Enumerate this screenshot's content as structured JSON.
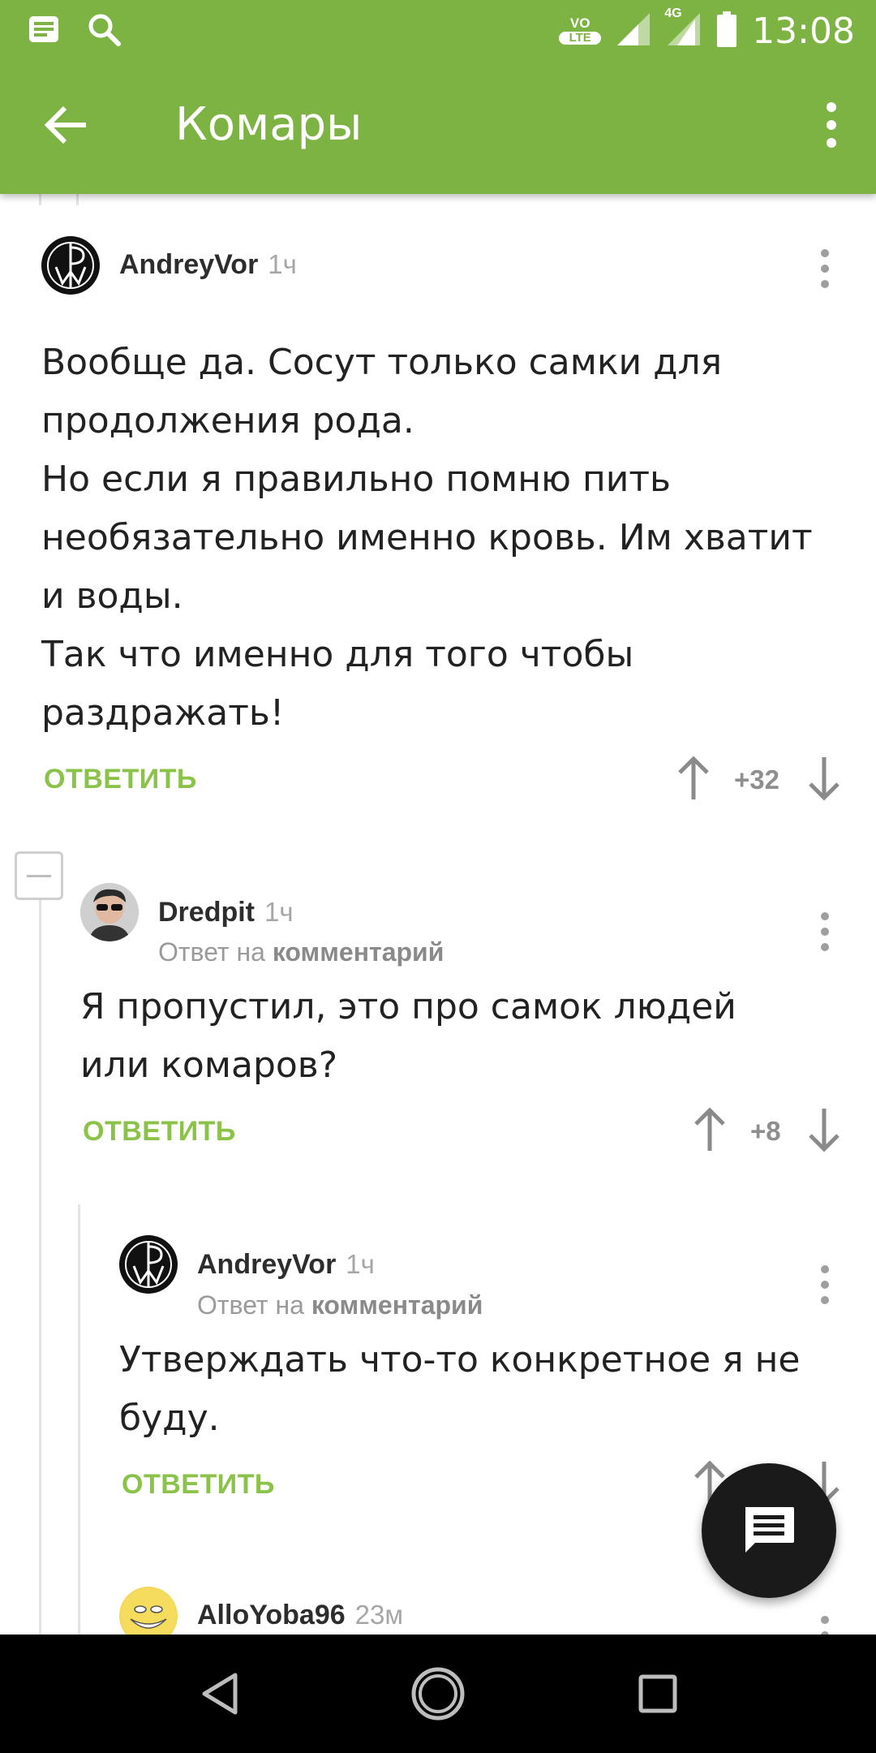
{
  "status_bar": {
    "time": "13:08",
    "network": "4G",
    "volte_top": "VO",
    "volte_bottom": "LTE"
  },
  "toolbar": {
    "title": "Комары"
  },
  "comments": [
    {
      "author": "AndreyVor",
      "age": "1ч",
      "body": "Вообще да. Сосут только самки для продолжения рода.\nНо если я правильно помню пить необязательно именно кровь. Им хватит и воды.\nТак что именно для того чтобы раздражать!",
      "reply_label": "ОТВЕТИТЬ",
      "rating": "+32"
    },
    {
      "author": "Dredpit",
      "age": "1ч",
      "reply_to_prefix": "Ответ на",
      "reply_to_target": "комментарий",
      "body": "Я пропустил, это про самок людей или комаров?",
      "reply_label": "ОТВЕТИТЬ",
      "rating": "+8"
    },
    {
      "author": "AndreyVor",
      "age": "1ч",
      "reply_to_prefix": "Ответ на",
      "reply_to_target": "комментарий",
      "body": "Утверждать что-то конкретное я не буду.",
      "reply_label": "ОТВЕТИТЬ"
    },
    {
      "author": "AlloYoba96",
      "age": "23м"
    }
  ],
  "colors": {
    "accent": "#7cb342",
    "reply_link": "#8bc34a",
    "fab": "#1a1a1a"
  }
}
